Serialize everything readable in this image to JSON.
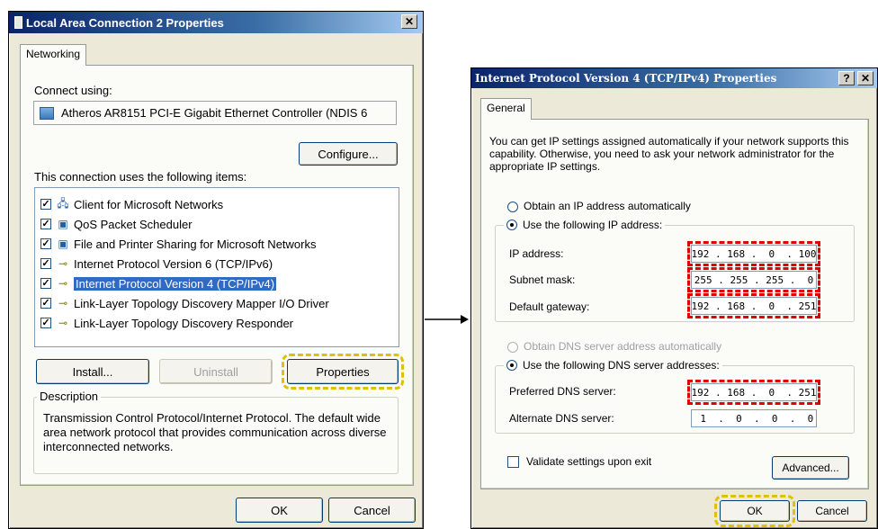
{
  "left_dialog": {
    "title": "Local Area Connection 2 Properties",
    "close_glyph": "✕",
    "tab": "Networking",
    "connect_using_label": "Connect using:",
    "adapter": "Atheros AR8151 PCI-E Gigabit Ethernet Controller (NDIS 6",
    "configure_label": "Configure...",
    "items_label": "This connection uses the following items:",
    "items": [
      {
        "label": "Client for Microsoft Networks",
        "checked": true,
        "icon": "network-client-icon"
      },
      {
        "label": "QoS Packet Scheduler",
        "checked": true,
        "icon": "computer-icon"
      },
      {
        "label": "File and Printer Sharing for Microsoft Networks",
        "checked": true,
        "icon": "computer-icon"
      },
      {
        "label": "Internet Protocol Version 6 (TCP/IPv6)",
        "checked": true,
        "icon": "protocol-icon"
      },
      {
        "label": "Internet Protocol Version 4 (TCP/IPv4)",
        "checked": true,
        "icon": "protocol-icon",
        "selected": true
      },
      {
        "label": "Link-Layer Topology Discovery Mapper I/O Driver",
        "checked": true,
        "icon": "protocol-icon"
      },
      {
        "label": "Link-Layer Topology Discovery Responder",
        "checked": true,
        "icon": "protocol-icon"
      }
    ],
    "install_label": "Install...",
    "uninstall_label": "Uninstall",
    "properties_label": "Properties",
    "description_legend": "Description",
    "description_text": "Transmission Control Protocol/Internet Protocol. The default wide area network protocol that provides communication across diverse interconnected networks.",
    "ok_label": "OK",
    "cancel_label": "Cancel"
  },
  "right_dialog": {
    "title": "Internet Protocol Version 4 (TCP/IPv4) Properties",
    "help_glyph": "?",
    "close_glyph": "✕",
    "tab": "General",
    "intro": "You can get IP settings assigned automatically if your network supports this capability. Otherwise, you need to ask your network administrator for the appropriate IP settings.",
    "obtain_ip_label": "Obtain an IP address automatically",
    "use_ip_label": "Use the following IP address:",
    "ip_address_label": "IP address:",
    "ip_address_value": "192 . 168 .  0  . 100",
    "subnet_label": "Subnet mask:",
    "subnet_value": "255 . 255 . 255 .  0",
    "gateway_label": "Default gateway:",
    "gateway_value": "192 . 168 .  0  . 251",
    "obtain_dns_label": "Obtain DNS server address automatically",
    "use_dns_label": "Use the following DNS server addresses:",
    "preferred_dns_label": "Preferred DNS server:",
    "preferred_dns_value": "192 . 168 .  0  . 251",
    "alternate_dns_label": "Alternate DNS server:",
    "alternate_dns_value": " 1  .  0  .  0  .  0",
    "validate_label": "Validate settings upon exit",
    "advanced_label": "Advanced...",
    "ok_label": "OK",
    "cancel_label": "Cancel"
  },
  "colors": {
    "highlight_red": "#e00000",
    "highlight_yellow": "#e0c000",
    "title_blue": "#0a246a"
  }
}
